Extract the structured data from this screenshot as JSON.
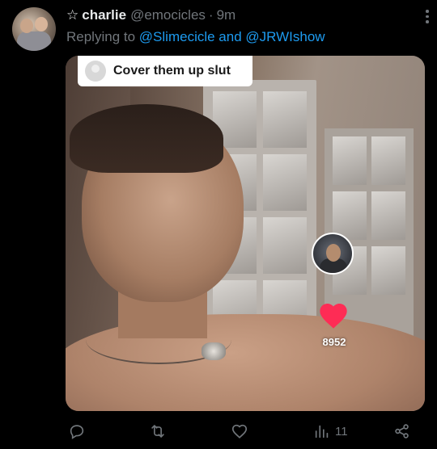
{
  "tweet": {
    "star_glyph": "☆",
    "display_name": "charlie",
    "handle": "@emocicles",
    "separator": "·",
    "time": "9m",
    "replying_prefix": "Replying to",
    "replying_to": "@Slimecicle and @JRWIshow"
  },
  "media": {
    "comment_text": "Cover them up slut",
    "like_count": "8952",
    "heart_color": "#fe2c55"
  },
  "actions": {
    "views_count": "11"
  },
  "colors": {
    "background": "#000000",
    "text_primary": "#e7e9ea",
    "text_secondary": "#71767b",
    "link": "#1d9bf0"
  }
}
